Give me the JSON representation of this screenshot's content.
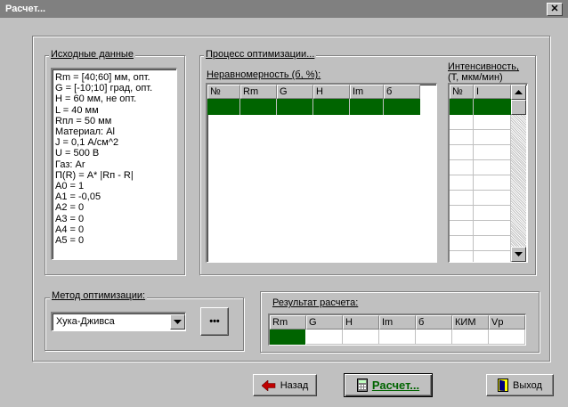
{
  "window": {
    "title": "Расчет...",
    "close_glyph": "✕"
  },
  "source": {
    "legend": "Исходные данные",
    "lines": [
      "Rm = [40;60] мм, опт.",
      "G = [-10;10] град, опт.",
      "H = 60 мм, не опт.",
      "L = 40 мм",
      "Rпл = 50 мм",
      "Материал: Al",
      "J = 0,1 А/см^2",
      "U = 500 В",
      "Газ: Ar",
      "П(R) =  A* |Rп - R|",
      "A0 = 1",
      "A1 = -0,05",
      "A2 = 0",
      "A3 = 0",
      "A4 = 0",
      "A5 = 0"
    ]
  },
  "optimization": {
    "legend": "Процесс оптимизации...",
    "nonuniformity_label": "Неравномерность (б, %):",
    "intensity_label_1": "Интенсивность,",
    "intensity_label_2": "(T, мкм/мин)",
    "nonuniformity_columns": [
      "№",
      "Rm",
      "G",
      "H",
      "Im",
      "б"
    ],
    "intensity_columns": [
      "№",
      "I"
    ]
  },
  "method": {
    "legend": "Метод оптимизации:",
    "selected": "Хука-Дживса",
    "more_label": "•••"
  },
  "result": {
    "legend": "Результат расчета:",
    "columns": [
      "Rm",
      "G",
      "H",
      "Im",
      "б",
      "КИМ",
      "Vp"
    ]
  },
  "buttons": {
    "back": "Назад",
    "calc": "Расчет...",
    "exit": "Выход"
  },
  "colors": {
    "selection": "#006400",
    "title_bar": "#808080",
    "face": "#c0c0c0"
  }
}
